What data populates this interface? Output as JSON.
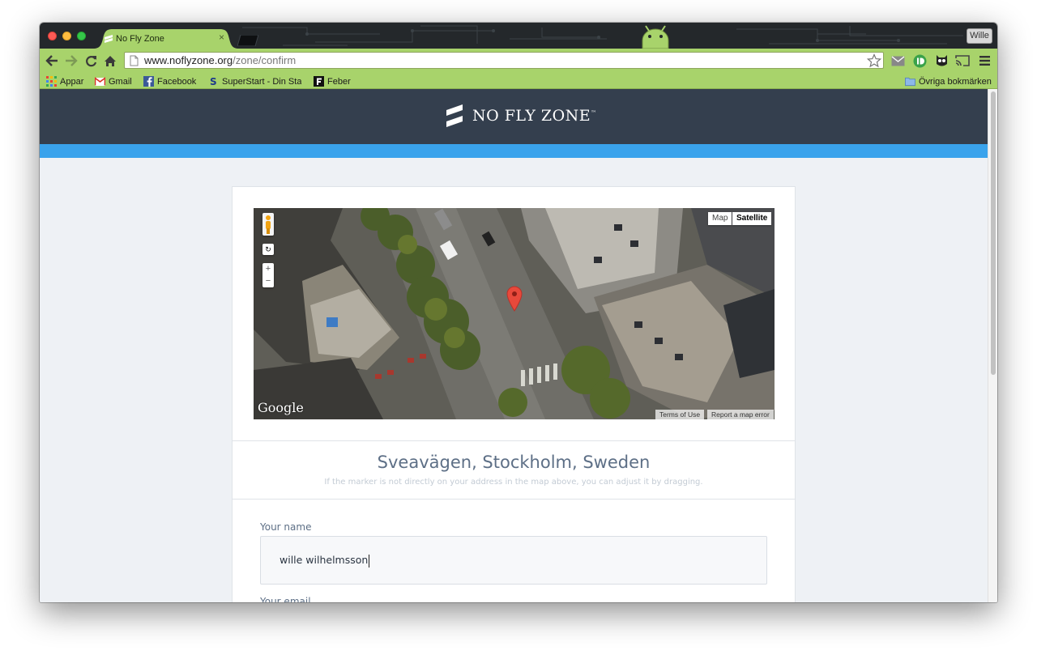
{
  "browser": {
    "tab_title": "No Fly Zone",
    "tab_close": "×",
    "user_name": "Wille",
    "url_host": "www.noflyzone.org",
    "url_path": "/zone/confirm"
  },
  "bookmarks": [
    {
      "label": "Appar",
      "icon": "apps-grid-icon"
    },
    {
      "label": "Gmail",
      "icon": "gmail-icon"
    },
    {
      "label": "Facebook",
      "icon": "facebook-icon"
    },
    {
      "label": "SuperStart - Din Sta",
      "icon": "superstart-icon"
    },
    {
      "label": "Feber",
      "icon": "feber-icon"
    }
  ],
  "other_bookmarks": "Övriga bokmärken",
  "site": {
    "logo_text": "NO FLY ZONE",
    "logo_tm": "™"
  },
  "map": {
    "type_map": "Map",
    "type_satellite": "Satellite",
    "active_type": "Satellite",
    "zoom_in": "+",
    "zoom_out": "−",
    "attribution": "Google",
    "terms": "Terms of Use",
    "report": "Report a map error"
  },
  "location": {
    "address": "Sveavägen, Stockholm, Sweden",
    "hint": "If the marker is not directly on your address in the map above, you can adjust it by dragging."
  },
  "form": {
    "name_label": "Your name",
    "name_value": "wille wilhelmsson",
    "email_label": "Your email"
  },
  "colors": {
    "toolbar_green": "#a8d36b",
    "header_navy": "#343f4e",
    "accent_blue": "#3aa3ec",
    "marker_red": "#e8493b"
  }
}
